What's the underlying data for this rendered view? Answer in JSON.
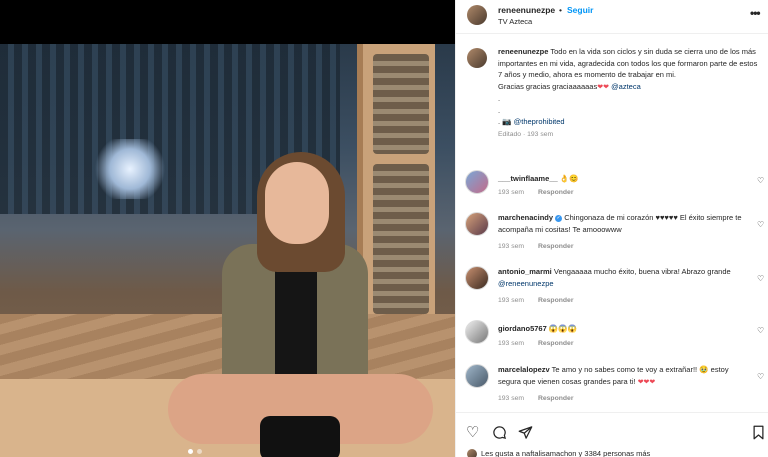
{
  "post": {
    "username": "reneenunezpe",
    "separator": "•",
    "follow_label": "Seguir",
    "location": "TV Azteca",
    "more_icon": "ellipsis-icon"
  },
  "caption": {
    "username": "reneenunezpe",
    "text": "Todo en la vida son ciclos y sin duda se cierra uno de los más importantes en mi vida, agradecida con todos los que formaron parte de estos 7 años y medio, ahora es momento de trabajar en mi.",
    "line2": "Gracias gracias graciaaaaaas",
    "line2_mention": "@azteca",
    "dot1": ".",
    "dot2": ".",
    "credit_prefix": ".",
    "credit_mention": "@theprohibited",
    "meta": "Editado · 193 sem"
  },
  "comments": [
    {
      "username": "___twinflaame__",
      "text": "👌😊",
      "time": "193 sem",
      "reply": "Responder"
    },
    {
      "username": "marchenacindy",
      "text": "Chingonaza de mi corazón ♥♥♥♥♥ El éxito siempre te acompaña mi cositas! Te amooowww",
      "time": "193 sem",
      "reply": "Responder"
    },
    {
      "username": "antonio_marmi",
      "text": "Vengaaaaa mucho éxito, buena vibra! Abrazo grande",
      "mention": "@reneenunezpe",
      "time": "193 sem",
      "reply": "Responder"
    },
    {
      "username": "giordano5767",
      "text": "😱😱😱",
      "time": "193 sem",
      "reply": "Responder"
    },
    {
      "username": "marcelalopezv",
      "text": "Te amo y no sabes como te voy a extrañar!! 🥹 estoy segura que vienen cosas grandes para ti!",
      "time": "193 sem",
      "reply": "Responder"
    }
  ],
  "actions": {
    "like_icon": "heart-icon",
    "comment_icon": "comment-icon",
    "share_icon": "paper-plane-icon",
    "save_icon": "bookmark-icon",
    "likes_text": "Les gusta a naftalisamachon y 3384 personas más"
  },
  "colors": {
    "accent": "#0095f6",
    "heart": "#ed4956",
    "muted": "#8e8e8e"
  }
}
